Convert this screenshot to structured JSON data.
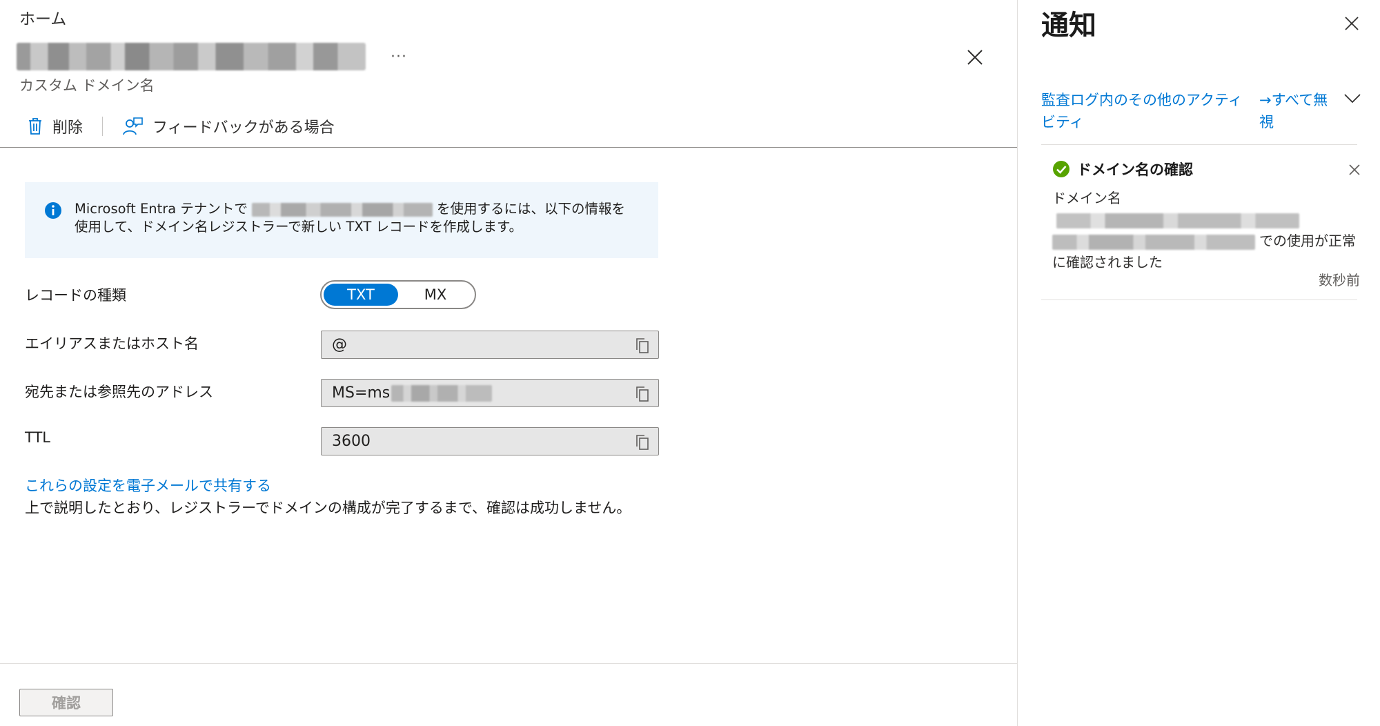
{
  "blade": {
    "breadcrumb": "ホーム",
    "more_label": "···",
    "subtitle": "カスタム ドメイン名",
    "toolbar": {
      "delete_label": "削除",
      "feedback_label": "フィードバックがある場合"
    },
    "info": {
      "text_before": "Microsoft Entra テナントで",
      "text_after": "を使用するには、以下の情報を使用して、ドメイン名レジストラーで新しい TXT レコードを作成します。"
    },
    "record_type": {
      "label": "レコードの種類",
      "options": [
        "TXT",
        "MX"
      ],
      "selected": "TXT"
    },
    "alias": {
      "label": "エイリアスまたはホスト名",
      "value": "@"
    },
    "destination": {
      "label": "宛先または参照先のアドレス",
      "value_prefix": "MS=ms"
    },
    "ttl": {
      "label": "TTL",
      "value": "3600"
    },
    "share_link": "これらの設定を電子メールで共有する",
    "note": "上で説明したとおり、レジストラーでドメインの構成が完了するまで、確認は成功しません。",
    "verify_button": "確認"
  },
  "notifications": {
    "title": "通知",
    "audit_link": "監査ログ内のその他のアクティビティ",
    "dismiss_all": "→すべて無視",
    "item": {
      "title": "ドメイン名の確認",
      "message_prefix": "ドメイン名",
      "message_suffix": "での使用が正常に確認されました",
      "time": "数秒前"
    }
  },
  "colors": {
    "accent": "#0078d4",
    "success": "#57a300",
    "info_bg": "#eff6fc",
    "readonly_bg": "#e6e6e6"
  },
  "icons": {
    "delete": "trash-icon",
    "feedback": "feedback-person-icon",
    "info": "info-icon",
    "copy": "copy-icon",
    "close": "close-icon",
    "expand": "chevron-down-icon",
    "success": "checkmark-circle-icon"
  }
}
